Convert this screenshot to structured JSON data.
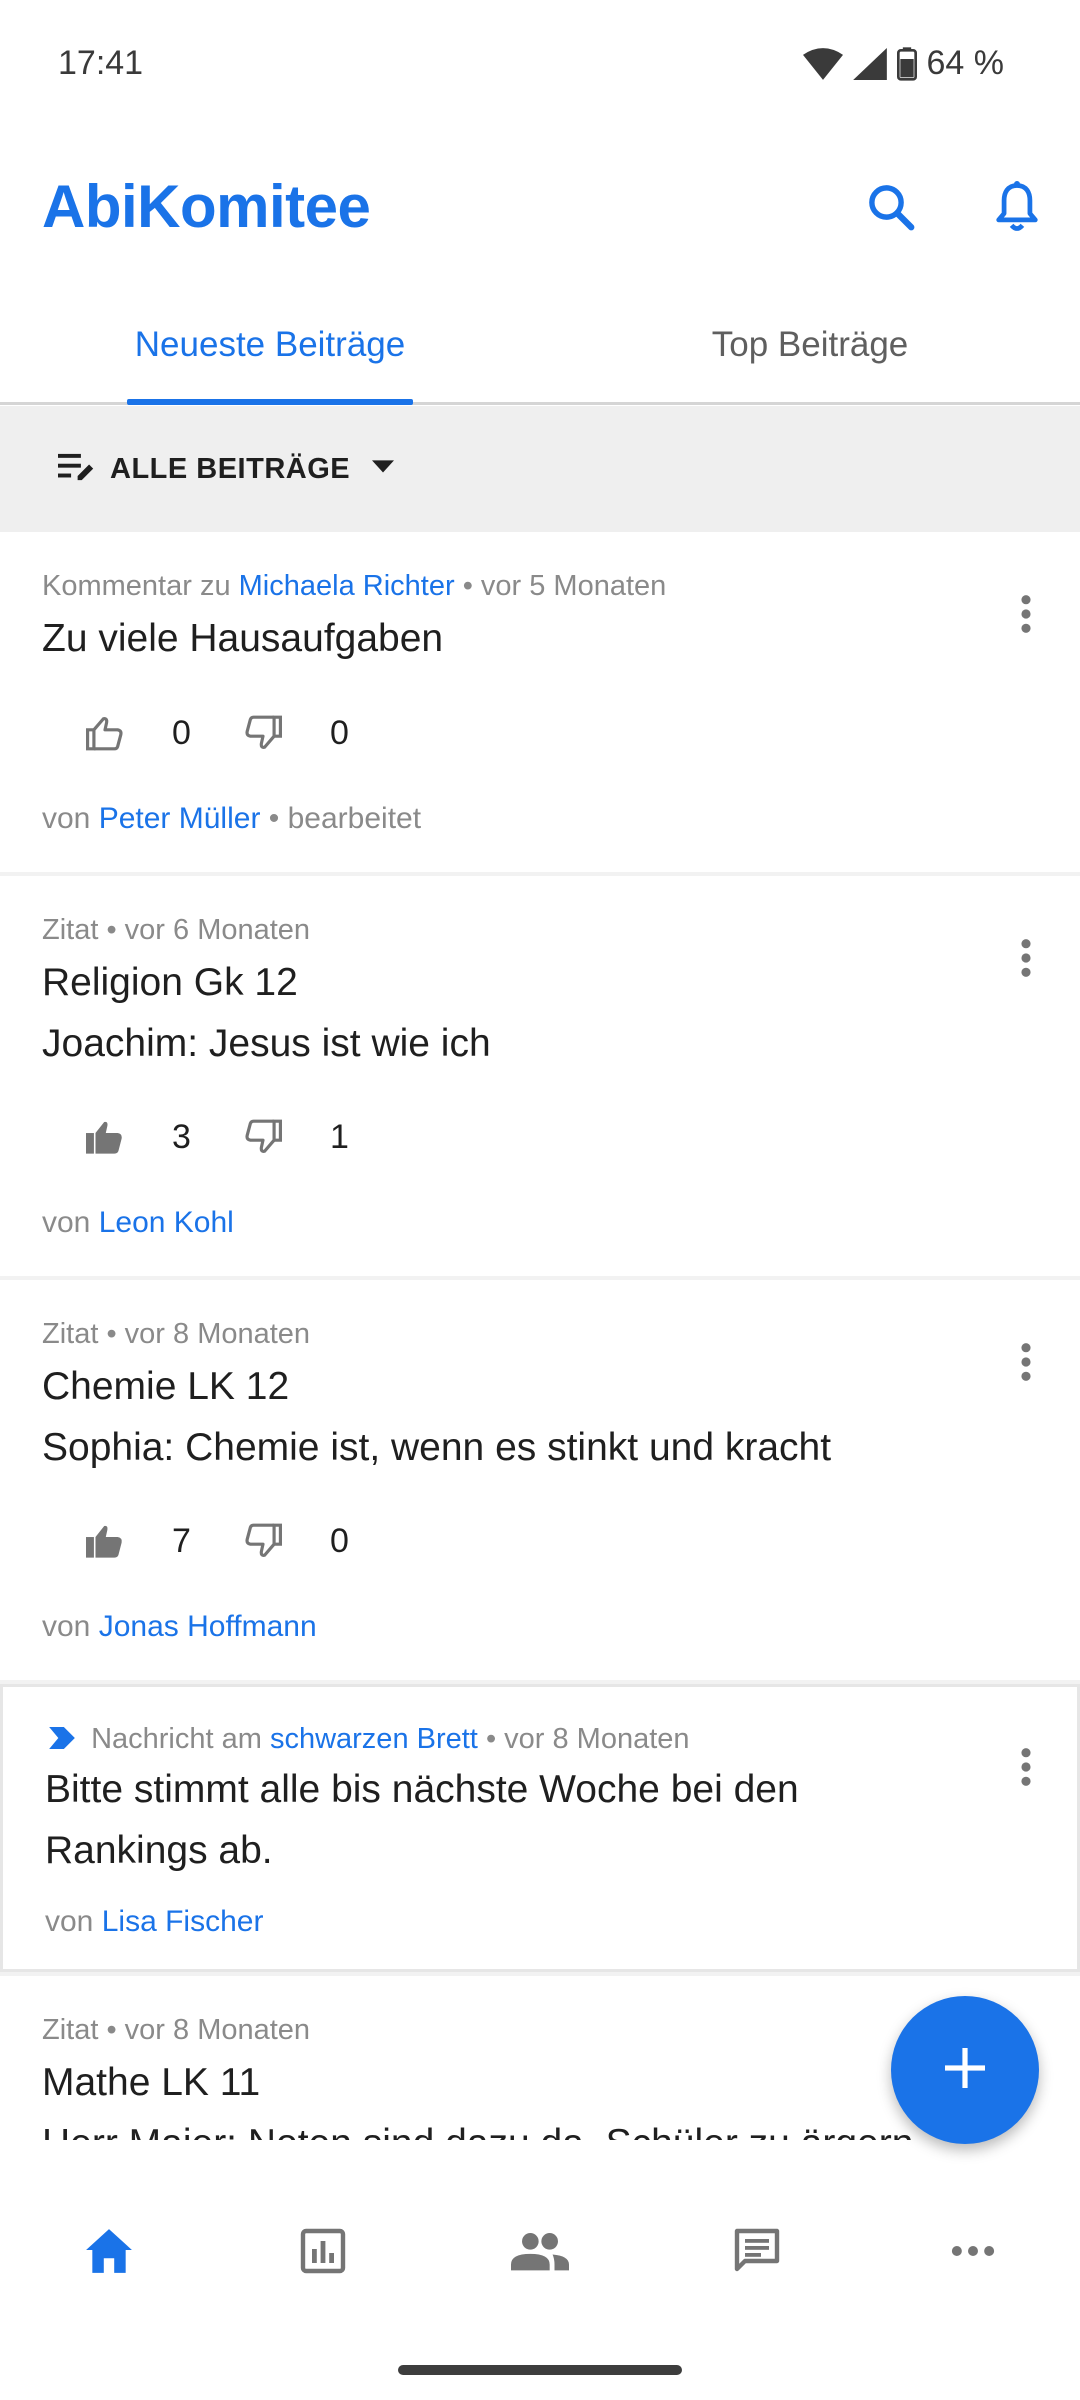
{
  "status_bar": {
    "time": "17:41",
    "battery": "64 %"
  },
  "header": {
    "title": "AbiKomitee"
  },
  "tabs": [
    {
      "label": "Neueste Beiträge"
    },
    {
      "label": "Top Beiträge"
    }
  ],
  "filter": {
    "label": "ALLE BEITRÄGE"
  },
  "posts": [
    {
      "type": "Kommentar zu",
      "type_link": "Michaela Richter",
      "time": "• vor 5 Monaten",
      "title_lines": [
        "Zu viele Hausaufgaben"
      ],
      "likes": "0",
      "dislikes": "0",
      "author_prefix": "von",
      "author": "Peter Müller",
      "author_suffix": "• bearbeitet"
    },
    {
      "type": "Zitat",
      "time": "• vor 6 Monaten",
      "title_lines": [
        "Religion Gk 12",
        "Joachim: Jesus ist wie ich"
      ],
      "likes": "3",
      "dislikes": "1",
      "author_prefix": "von",
      "author": "Leon Kohl"
    },
    {
      "type": "Zitat",
      "time": "• vor 8 Monaten",
      "title_lines": [
        "Chemie LK 12",
        "Sophia: Chemie ist, wenn es stinkt und kracht"
      ],
      "likes": "7",
      "dislikes": "0",
      "author_prefix": "von",
      "author": "Jonas Hoffmann"
    },
    {
      "type": "Nachricht am",
      "type_link": "schwarzen Brett",
      "time": "• vor 8 Monaten",
      "title_lines": [
        "Bitte stimmt alle bis nächste Woche bei den",
        "Rankings ab."
      ],
      "author_prefix": "von",
      "author": "Lisa Fischer"
    },
    {
      "type": "Zitat",
      "time": "• vor 8 Monaten",
      "title_lines": [
        "Mathe LK 11",
        "Herr Maier: Noten sind dazu da, Schüler zu ärgern"
      ]
    }
  ],
  "colors": {
    "accent": "#1a73e8",
    "muted": "#8a8a8a",
    "icon_gray": "#757575"
  },
  "icons": {
    "header": [
      "search-icon",
      "bell-icon"
    ],
    "bottom_nav": [
      "home-icon",
      "chart-icon",
      "people-icon",
      "chat-icon",
      "more-horizontal-icon"
    ],
    "fab": "plus-icon"
  }
}
